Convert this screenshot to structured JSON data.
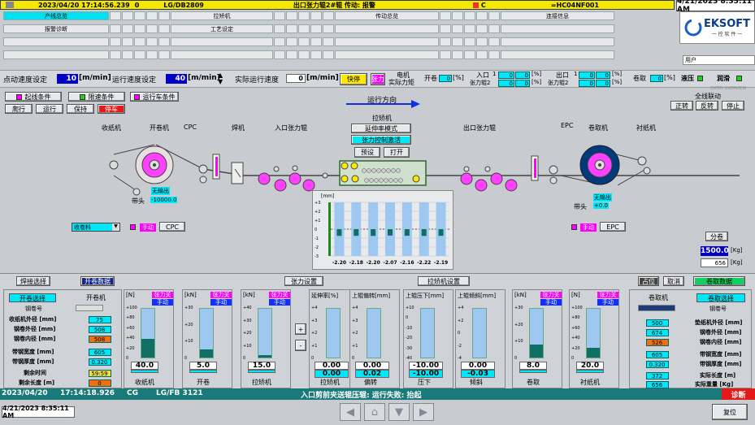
{
  "alarm": {
    "datetime": "2023/04/20 17:14:56.239",
    "code": "0",
    "station": "LG/DB2809",
    "message": "出口张力辊2#辊 传动: 报警",
    "flag": "C",
    "ref": "=HC04NF001"
  },
  "clock": "4/21/2023 8:35:11 AM",
  "logo": "EKSOFT",
  "logo_sub": "一 控 软 件 一",
  "user_label": "用户",
  "nav": {
    "row1": [
      "产线总览",
      "拉矫机",
      "传动总览",
      "连接信息"
    ],
    "row2": [
      "报警诊断",
      "工艺设定"
    ]
  },
  "speed": {
    "jog_label": "点动速度设定",
    "jog_value": "10",
    "run_label": "运行速度设定",
    "run_value": "40",
    "unit": "[m/min]",
    "actual_label": "实际运行速度",
    "actual_value": "0",
    "fast_stop": "快停",
    "tension": "张力",
    "motor_torque_l1": "电机",
    "motor_torque_l2": "实际力矩",
    "uncoil": "开卷",
    "uncoil_val": "0",
    "pct": "[%]",
    "entry": "入口",
    "entry_roll2": "张力辊2",
    "exit": "出口",
    "exit_roll2": "张力辊2",
    "entry_v1": "0",
    "entry_v2": "0",
    "entry_p1": "0",
    "entry_p2": "0",
    "exit_v1": "0",
    "exit_v2": "0",
    "exit_p1": "0",
    "exit_p2": "0",
    "one": "1",
    "recoil": "卷取",
    "recoil_val": "0",
    "hydraulic": "液压",
    "lube": "润滑",
    "entry_over": "ENTRY OVERVIEW"
  },
  "line": {
    "cond1": "起线条件",
    "cond2": "限速条件",
    "cond3": "运行车条件",
    "jog": "爬行",
    "run": "运行",
    "hold": "保持",
    "stop": "停车",
    "direction": "运行方向",
    "full_link": "全线联动",
    "fwd": "正转",
    "rev": "反转",
    "halt": "停止",
    "paper_uncoil": "收纸机",
    "uncoiler": "开卷机",
    "cpc": "CPC",
    "welder": "焊机",
    "entry_bridle": "入口张力辊",
    "leveler": "拉矫机",
    "elong_mode": "延伸率模式",
    "tension_ctrl": "张力控制激活",
    "preset": "预设",
    "open": "打开",
    "exit_bridle": "出口张力辊",
    "epc": "EPC",
    "recoiler": "卷取机",
    "paper_rewind": "衬纸机",
    "no_output": "无输出",
    "head": "带头",
    "uncoil_pos": "-10000.0",
    "recoil_pos": "+0.0",
    "manual": "手动",
    "cpc_btn": "CPC",
    "epc_btn": "EPC",
    "combo": "收卷料",
    "split": "分卷",
    "len_set": "1500.0",
    "len_act": "656",
    "kg": "[Kg]"
  },
  "chart_data": {
    "type": "bar",
    "title": "",
    "ylabel": "[mm]",
    "ylim": [
      -3,
      3
    ],
    "ticks": [
      "+3",
      "+2",
      "+1",
      "0",
      "-1",
      "-2",
      "-3"
    ],
    "categories": [
      "1",
      "2",
      "3",
      "4",
      "5",
      "6",
      "7"
    ],
    "values": [
      -2.2,
      -2.18,
      -2.2,
      -2.07,
      -2.16,
      -2.22,
      -2.19
    ],
    "labels": [
      "-2.20",
      "-2.18",
      "-2.20",
      "-2.07",
      "-2.16",
      "-2.22",
      "-2.19"
    ]
  },
  "bottom": {
    "weld_sel": "焊接选择",
    "uncoil_data": "开卷数据",
    "tension_set": "张力设置",
    "leveler_set": "拉矫机设置",
    "occupy": "占位",
    "cancel": "取消",
    "recoil_data": "卷取数据",
    "left_hdr1": "开卷选择",
    "left_hdr2": "开卷机",
    "coil_no": "钢卷号",
    "paper_od": "收纸机外径 [mm]",
    "coil_od": "钢卷外径 [mm]",
    "coil_id": "钢卷内径 [mm]",
    "width": "带钢宽度 [mm]",
    "thick": "带钢厚度 [mm]",
    "remain_t": "剩余时间",
    "remain_l": "剩余长度 [m]",
    "v_paper": "75",
    "v_od": "508",
    "v_id": "508",
    "v_w": "605",
    "v_t": "0.320",
    "v_rt": "59:59",
    "v_rl": "0",
    "right_hdr1": "卷取机",
    "right_hdr2": "卷取选择",
    "r_paper": "垫纸机外径 [mm]",
    "r_od": "钢卷外径 [mm]",
    "r_id": "钢卷内径 [mm]",
    "r_w": "带钢宽度 [mm]",
    "r_t": "带钢厚度 [mm]",
    "r_len": "实际长度 [m]",
    "r_wt": "实际重量 [Kg]",
    "rv_paper": "500",
    "rv_od": "674",
    "rv_id": "526",
    "rv_w": "605",
    "rv_t": "0.320",
    "rv_len": "372",
    "rv_wt": "656",
    "tension_on": "张力关断",
    "manual": "手动",
    "plus": "+",
    "minus": "-"
  },
  "gauges": [
    {
      "unit": "[N]",
      "ticks": [
        "+100",
        "+80",
        "+60",
        "+40",
        "+20",
        "0"
      ],
      "value": "40.0",
      "name": "收纸机",
      "fill": 0.38,
      "tag": true
    },
    {
      "unit": "[kN]",
      "ticks": [
        "+30",
        "+20",
        "+10",
        "0"
      ],
      "value": "5.0",
      "name": "开卷",
      "fill": 0.16,
      "tag": true
    },
    {
      "unit": "[kN]",
      "ticks": [
        "+40",
        "+30",
        "+20",
        "+10",
        "0"
      ],
      "value": "15.0",
      "name": "拉矫机",
      "fill": 0.05,
      "tag": true
    },
    {
      "unit": "延伸率[%]",
      "ticks": [
        "+4",
        "+3",
        "+2",
        "+1",
        "0"
      ],
      "value": "0.00",
      "name": "拉矫机",
      "fill": 0.0,
      "tag": false,
      "unit2": "0.00"
    },
    {
      "unit": "上辊偏转[mm]",
      "ticks": [
        "+4",
        "+3",
        "+2",
        "+1",
        "0"
      ],
      "value": "0.00",
      "name": "偏转",
      "fill": 0.0,
      "tag": false,
      "unit2": "0.02"
    },
    {
      "unit": "上辊压下[mm]",
      "ticks": [
        "+10",
        "0",
        "-10",
        "-20",
        "-30",
        "-40"
      ],
      "value": "-10.00",
      "name": "压下",
      "fill": 0.0,
      "tag": false,
      "unit2": "-10.00"
    },
    {
      "unit": "上辊倾斜[mm]",
      "ticks": [
        "+4",
        "+2",
        "0",
        "-2",
        "-4"
      ],
      "value": "0.00",
      "name": "倾斜",
      "fill": 0.0,
      "tag": false,
      "unit2": "-0.03"
    },
    {
      "unit": "[kN]",
      "ticks": [
        "+30",
        "+20",
        "+10",
        "0"
      ],
      "value": "8.0",
      "name": "卷取",
      "fill": 0.27,
      "tag": true
    },
    {
      "unit": "[N]",
      "ticks": [
        "+100",
        "+80",
        "+60",
        "+40",
        "+20",
        "0"
      ],
      "value": "20.0",
      "name": "衬纸机",
      "fill": 0.2,
      "tag": true
    }
  ],
  "status": {
    "date": "2023/04/20",
    "time": "17:14:18.926",
    "cg": "CG",
    "station": "LG/FB 3121",
    "msg": "入口剪前夹送辊压辊: 运行失败: 抬起",
    "diag": "诊断"
  },
  "footer": {
    "clock": "4/21/2023 8:35:11 AM",
    "reset": "复位"
  }
}
